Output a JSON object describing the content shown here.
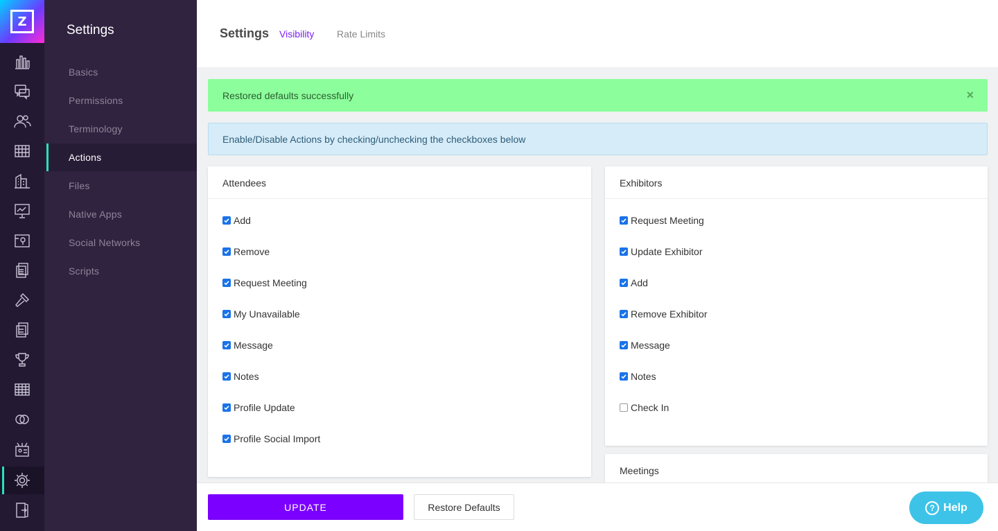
{
  "logo": {
    "letter": "Z"
  },
  "rail": {
    "icons": [
      "analytics-icon",
      "chat-icon",
      "people-icon",
      "table-icon",
      "building-icon",
      "presentation-icon",
      "map-icon",
      "documents-icon",
      "hammer-icon",
      "forms-icon",
      "trophy-icon",
      "grid-icon",
      "rings-icon",
      "badge-icon",
      "gear-icon",
      "exit-icon"
    ]
  },
  "sidebar": {
    "title": "Settings",
    "items": [
      "Basics",
      "Permissions",
      "Terminology",
      "Actions",
      "Files",
      "Native Apps",
      "Social Networks",
      "Scripts"
    ],
    "active": "Actions"
  },
  "header": {
    "title": "Settings",
    "tabs": [
      {
        "label": "Visibility",
        "active": true
      },
      {
        "label": "Rate Limits",
        "active": false
      }
    ]
  },
  "alerts": {
    "success": "Restored defaults successfully",
    "close": "×",
    "info": "Enable/Disable Actions by checking/unchecking the checkboxes below"
  },
  "cards": {
    "attendees": {
      "title": "Attendees",
      "items": [
        {
          "label": "Add",
          "checked": true
        },
        {
          "label": "Remove",
          "checked": true
        },
        {
          "label": "Request Meeting",
          "checked": true
        },
        {
          "label": "My Unavailable",
          "checked": true
        },
        {
          "label": "Message",
          "checked": true
        },
        {
          "label": "Notes",
          "checked": true
        },
        {
          "label": "Profile Update",
          "checked": true
        },
        {
          "label": "Profile Social Import",
          "checked": true
        }
      ]
    },
    "exhibitors": {
      "title": "Exhibitors",
      "items": [
        {
          "label": "Request Meeting",
          "checked": true
        },
        {
          "label": "Update Exhibitor",
          "checked": true
        },
        {
          "label": "Add",
          "checked": true
        },
        {
          "label": "Remove Exhibitor",
          "checked": true
        },
        {
          "label": "Message",
          "checked": true
        },
        {
          "label": "Notes",
          "checked": true
        },
        {
          "label": "Check In",
          "checked": false
        }
      ]
    },
    "meetings": {
      "title": "Meetings"
    }
  },
  "footer": {
    "update": "UPDATE",
    "restore": "Restore Defaults",
    "help": "Help",
    "help_glyph": "?"
  },
  "colors": {
    "accent": "#7b00ff",
    "active_indicator": "#29e0c0",
    "success_bg": "#8cff9c",
    "info_bg": "#d6ecf8",
    "help_bg": "#3ec3e8"
  }
}
